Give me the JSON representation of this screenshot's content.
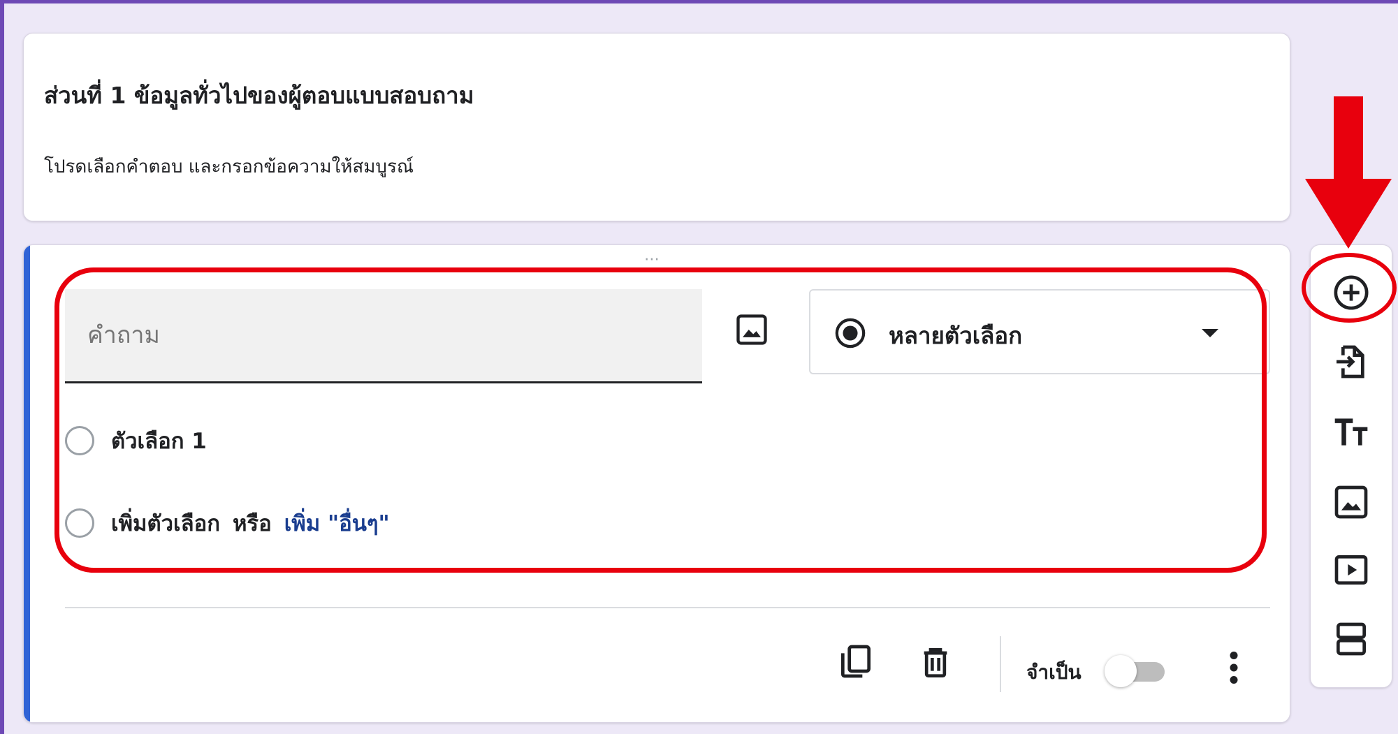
{
  "section_header": {
    "title": "ส่วนที่ 1 ข้อมูลทั่วไปของผู้ตอบแบบสอบถาม",
    "description": "โปรดเลือกคำตอบ และกรอกข้อความให้สมบูรณ์"
  },
  "question": {
    "placeholder": "คำถาม",
    "type_label": "หลายตัวเลือก",
    "options": [
      "ตัวเลือก 1"
    ],
    "add_option": "เพิ่มตัวเลือก",
    "or": "หรือ",
    "add_other": "เพิ่ม \"อื่นๆ\"",
    "required_label": "จำเป็น",
    "required_on": false
  },
  "toolbar": {
    "items": [
      "add-question-icon",
      "import-questions-icon",
      "add-title-icon",
      "add-image-icon",
      "add-video-icon",
      "add-section-icon"
    ]
  },
  "colors": {
    "accent": "#3063d6",
    "frame": "#6e49b5",
    "annotation": "#e8000d",
    "link": "#1a3d8f"
  }
}
